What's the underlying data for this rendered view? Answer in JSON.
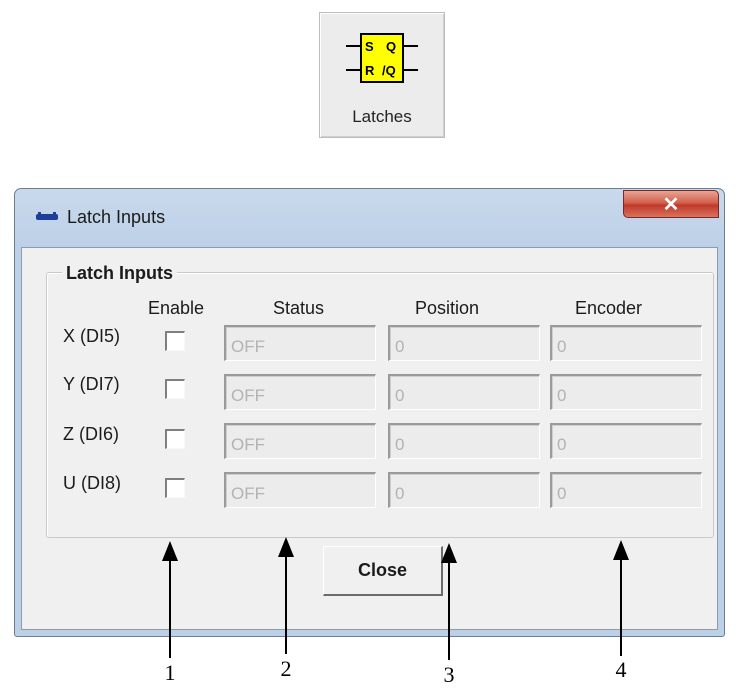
{
  "toolbar_button": {
    "label": "Latches",
    "icon": "flip-flop-icon",
    "icon_pins": [
      "S",
      "Q",
      "R",
      "/Q"
    ]
  },
  "dialog": {
    "title": "Latch Inputs",
    "close_glyph": "✕",
    "group_title": "Latch Inputs",
    "columns": [
      "Enable",
      "Status",
      "Position",
      "Encoder"
    ],
    "rows": [
      {
        "label": "X (DI5)",
        "enabled": false,
        "status": "OFF",
        "position": "0",
        "encoder": "0"
      },
      {
        "label": "Y (DI7)",
        "enabled": false,
        "status": "OFF",
        "position": "0",
        "encoder": "0"
      },
      {
        "label": "Z (DI6)",
        "enabled": false,
        "status": "OFF",
        "position": "0",
        "encoder": "0"
      },
      {
        "label": "U (DI8)",
        "enabled": false,
        "status": "OFF",
        "position": "0",
        "encoder": "0"
      }
    ],
    "close_button": "Close"
  },
  "callouts": [
    "1",
    "2",
    "3",
    "4"
  ],
  "colors": {
    "icon_fill": "#ffff00",
    "window_frame": "#bcd0e7",
    "close_red": "#c0392b",
    "disabled_text": "#b3b3b3"
  }
}
